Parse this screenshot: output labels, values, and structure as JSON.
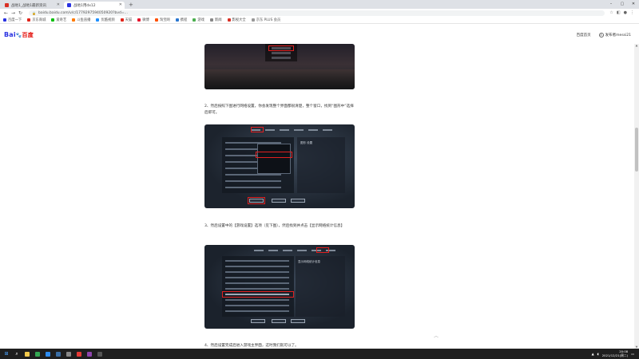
{
  "browser": {
    "tabs": [
      {
        "title": "战地1_战地1最新资讯",
        "active": false,
        "favicon_color": "#d93025"
      },
      {
        "title": "战地1用dx12",
        "active": true,
        "favicon_color": "#2932e1"
      }
    ],
    "new_tab": "+",
    "url": "baidu.baidu.com/v/c/1779297594050920?bvd=...",
    "window_controls": [
      "–",
      "▢",
      "✕"
    ]
  },
  "bookmarks": [
    {
      "label": "百度一下",
      "color": "#2932e1"
    },
    {
      "label": "京东商城",
      "color": "#e1251b"
    },
    {
      "label": "爱奇艺",
      "color": "#00be06"
    },
    {
      "label": "斗鱼直播",
      "color": "#ff7a00"
    },
    {
      "label": "优酷视频",
      "color": "#1e90ff"
    },
    {
      "label": "天猫",
      "color": "#e1251b"
    },
    {
      "label": "微博",
      "color": "#e6162d"
    },
    {
      "label": "淘宝网",
      "color": "#ff5000"
    },
    {
      "label": "携程",
      "color": "#2a77d1"
    },
    {
      "label": "游戏",
      "color": "#4caf50"
    },
    {
      "label": "新闻",
      "color": "#888888"
    },
    {
      "label": "影视大全",
      "color": "#d93025"
    },
    {
      "label": "京东 PLUS 会员",
      "color": "#999999"
    }
  ],
  "header": {
    "logo_part1": "Bai",
    "logo_paw": "🐾",
    "logo_part2": "百度",
    "home_link": "百度首页",
    "avatar_glyph": "人",
    "username": "发布者messi21"
  },
  "steps": [
    {
      "text": "2、然后按照下图进行网络设置，你会发现整个界面都很清楚，整个窗口，找到“图形中”选择后即可。"
    },
    {
      "text": "3、然后设置中的【游戏设置】选项（见下图），然后找到并点击【显示网络统计信息】"
    },
    {
      "text": "4、然后设置完成后进入游戏主界面，这时我们就可以了。"
    }
  ],
  "game_panels": {
    "panel2_title": "图形 设置",
    "panel3_title": "显示网络统计信息"
  },
  "scroll": {
    "up": "▲",
    "down": "▼",
    "back_to_top": "︿"
  },
  "taskbar": {
    "start": "⊞",
    "search": "⌕",
    "apps": [
      {
        "name": "file-explorer",
        "color": "#f2c94c"
      },
      {
        "name": "chrome",
        "color": "#34a853"
      },
      {
        "name": "app-blue",
        "color": "#2d8cf0"
      },
      {
        "name": "steam",
        "color": "#3a6ea5"
      },
      {
        "name": "app-gray",
        "color": "#888888"
      },
      {
        "name": "app-red",
        "color": "#e53935"
      },
      {
        "name": "app-purple",
        "color": "#8e44ad"
      },
      {
        "name": "app-dark",
        "color": "#555555"
      }
    ],
    "time": "20:08",
    "date": "2021/12/21(周二)"
  }
}
